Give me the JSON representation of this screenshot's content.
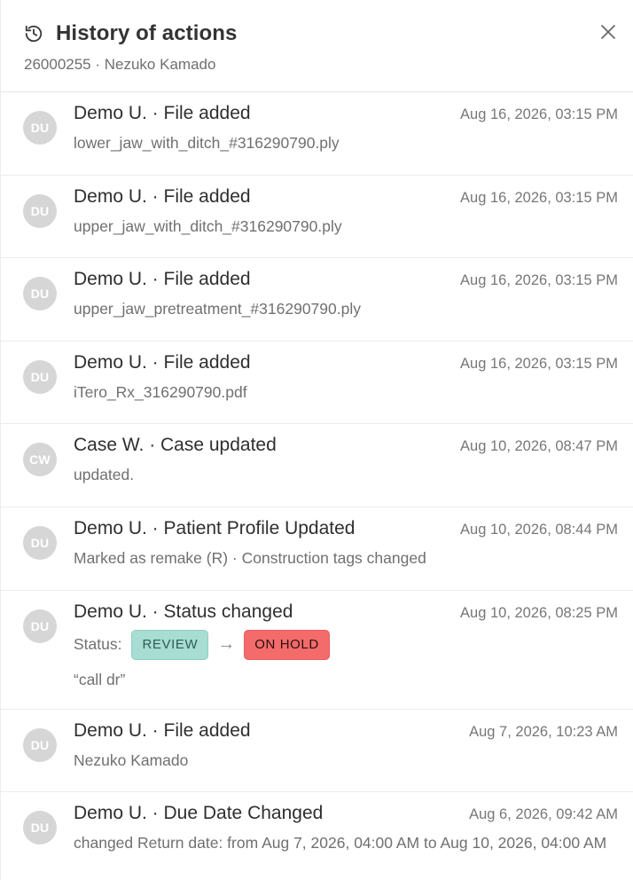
{
  "header": {
    "title": "History of actions",
    "subtitle": "26000255 · Nezuko Kamado",
    "close_icon": "close-icon",
    "history_icon": "history-icon"
  },
  "colors": {
    "avatar_bg": "#d6d6d6",
    "review_badge_bg": "#a8ddd3",
    "on_hold_badge_bg": "#f36b6b"
  },
  "entries": [
    {
      "initials": "DU",
      "action": "Demo U. · File added",
      "time": "Aug 16, 2026, 03:15 PM",
      "detail": "lower_jaw_with_ditch_#316290790.ply"
    },
    {
      "initials": "DU",
      "action": "Demo U. · File added",
      "time": "Aug 16, 2026, 03:15 PM",
      "detail": "upper_jaw_with_ditch_#316290790.ply"
    },
    {
      "initials": "DU",
      "action": "Demo U. · File added",
      "time": "Aug 16, 2026, 03:15 PM",
      "detail": "upper_jaw_pretreatment_#316290790.ply"
    },
    {
      "initials": "DU",
      "action": "Demo U. · File added",
      "time": "Aug 16, 2026, 03:15 PM",
      "detail": "iTero_Rx_316290790.pdf"
    },
    {
      "initials": "CW",
      "action": "Case W. · Case updated",
      "time": "Aug 10, 2026, 08:47 PM",
      "detail": "updated."
    },
    {
      "initials": "DU",
      "action": "Demo U. · Patient Profile Updated",
      "time": "Aug 10, 2026, 08:44 PM",
      "detail": "Marked as remake (R) · Construction tags changed"
    },
    {
      "initials": "DU",
      "action": "Demo U. · Status changed",
      "time": "Aug 10, 2026, 08:25 PM",
      "status_label": "Status:",
      "from_status": "REVIEW",
      "arrow": "→",
      "to_status": "ON HOLD",
      "note": "“call dr”"
    },
    {
      "initials": "DU",
      "action": "Demo U. · File added",
      "time": "Aug 7, 2026, 10:23 AM",
      "detail": "Nezuko Kamado"
    },
    {
      "initials": "DU",
      "action": "Demo U. · Due Date Changed",
      "time": "Aug 6, 2026, 09:42 AM",
      "detail": "changed Return date: from Aug 7, 2026, 04:00 AM to Aug 10, 2026, 04:00 AM"
    }
  ]
}
